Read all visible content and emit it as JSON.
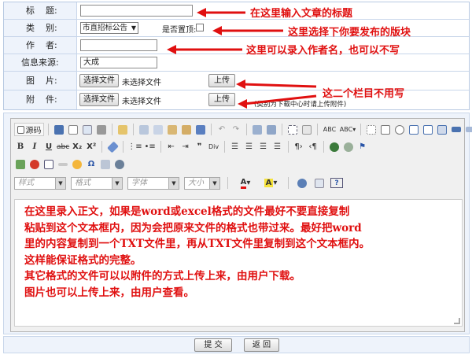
{
  "form": {
    "title_label": "标    题:",
    "category_label": "类    别:",
    "category_value": "市直招标公告",
    "pin_label": "是否置顶:",
    "author_label": "作    者:",
    "source_label": "信息来源:",
    "source_value": "大成",
    "image_label": "图    片:",
    "attach_label": "附    件:",
    "choose_file": "选择文件",
    "no_file": "未选择文件",
    "upload": "上传",
    "attach_hint": "(类别为下载中心时请上传附件)"
  },
  "annotations": {
    "title_hint": "在这里输入文章的标题",
    "category_hint": "这里选择下你要发布的版块",
    "author_hint": "这里可以录入作者名，也可以不写",
    "upload_hint": "这二个栏目不用写",
    "accent_color": "#e01010"
  },
  "editor": {
    "source_label": "源码",
    "combo_style": "样式",
    "combo_format": "格式",
    "combo_font": "字体",
    "combo_size": "大小",
    "bold": "B",
    "italic": "I",
    "underline": "U",
    "strike": "abc",
    "sub": "X₂",
    "sup": "X²",
    "content_lines": [
      "在这里录入正文，如果是word或excel格式的文件最好不要直接复制",
      "粘贴到这个文本框内，因为会把原来文件的格式也带过来。最好把word",
      "里的内容复制到一个TXT文件里，再从TXT文件里复制到这个文本框内。",
      "这样能保证格式的完整。",
      "其它格式的文件可以以附件的方式上传上来，由用户下载。",
      "图片也可以上传上来，由用户查看。"
    ]
  },
  "footer": {
    "submit": "提 交",
    "back": "返 回"
  }
}
